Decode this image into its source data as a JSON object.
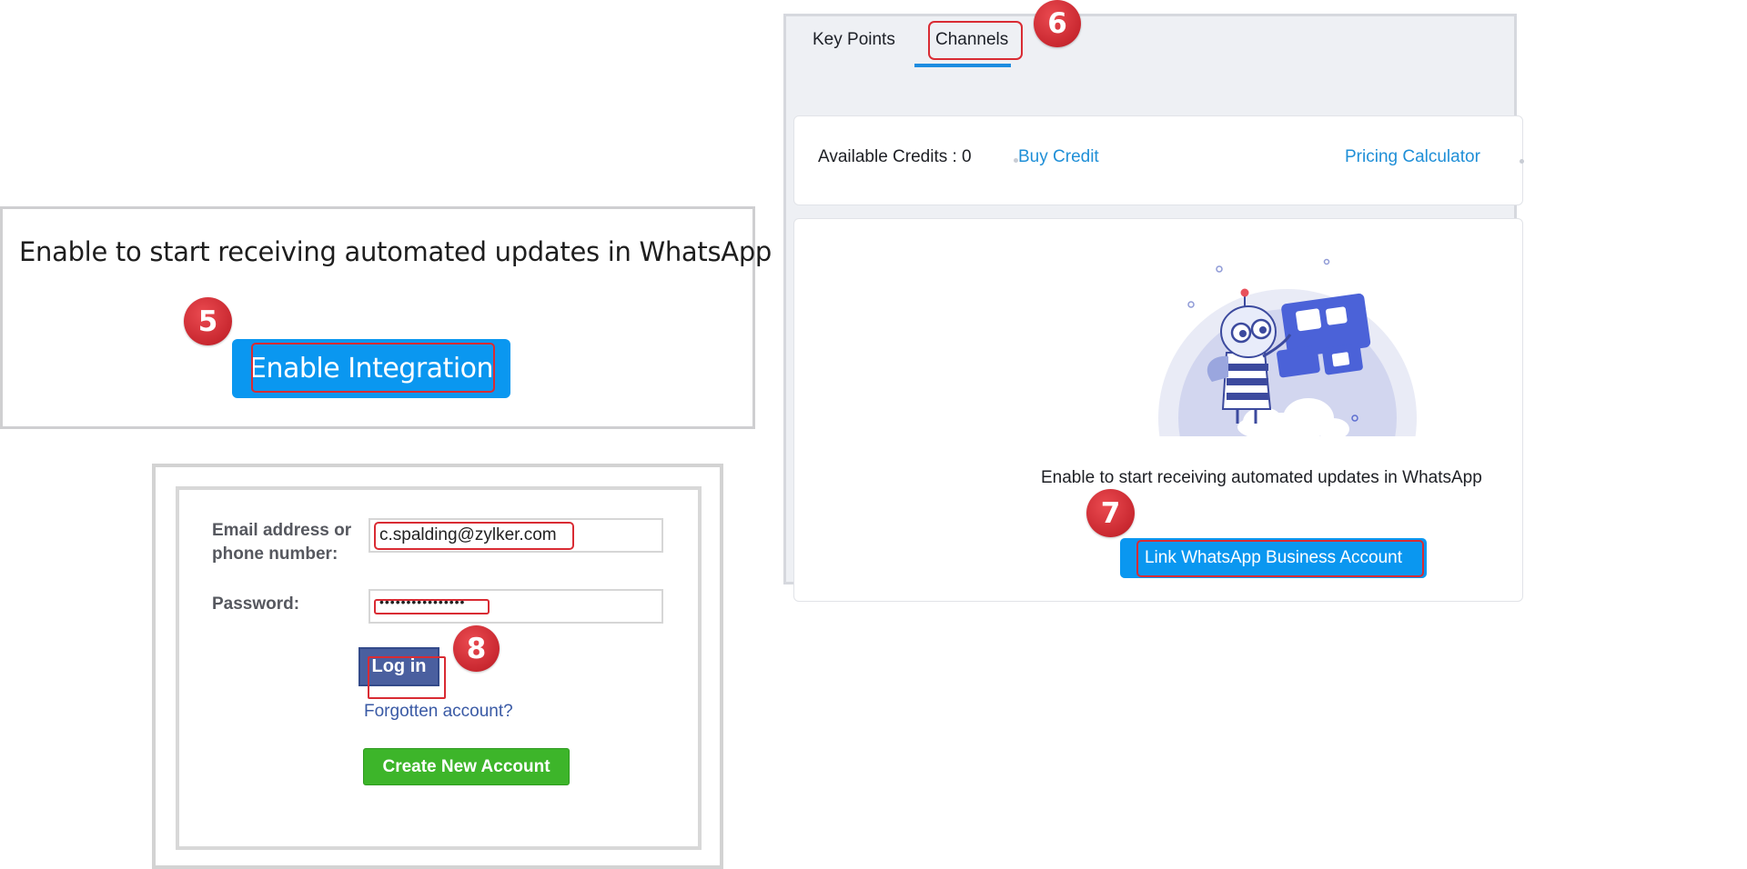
{
  "panel_enable": {
    "message": "Enable to start receiving automated updates in WhatsApp",
    "button_label": "Enable Integration",
    "step": "5"
  },
  "panel_login": {
    "email_label_line1": "Email address or",
    "email_label_line2": "phone number:",
    "email_value": "c.spalding@zylker.com",
    "password_label": "Password:",
    "password_value": "••••••••••••••••",
    "login_label": "Log in",
    "forgot_label": "Forgotten account?",
    "create_label": "Create New Account",
    "step": "8"
  },
  "panel_channels": {
    "tabs": [
      {
        "label": "Key Points"
      },
      {
        "label": "Channels"
      }
    ],
    "tab_step": "6",
    "credits_label": "Available Credits : 0",
    "buy_credit": "Buy Credit",
    "pricing_calculator": "Pricing Calculator",
    "message": "Enable to start receiving automated updates in WhatsApp",
    "link_button": "Link WhatsApp Business Account",
    "link_step": "7"
  },
  "colors": {
    "accent_blue": "#0a97f0",
    "badge_red": "#c92830",
    "facebook_blue": "#4a5f9f",
    "create_green": "#3db52a"
  }
}
